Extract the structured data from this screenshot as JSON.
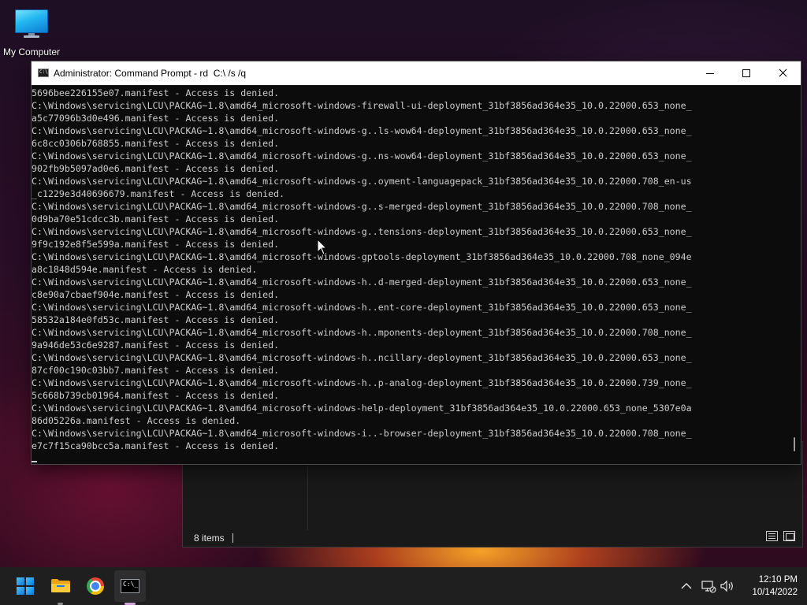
{
  "desktop": {
    "icons": [
      {
        "label": "My Computer",
        "icon": "computer-monitor-icon"
      }
    ]
  },
  "explorer": {
    "status_items": "8 items"
  },
  "cmd_window": {
    "title": "Administrator: Command Prompt - rd  C:\\ /s /q",
    "lines": [
      "5696bee226155e07.manifest - Access is denied.",
      "C:\\Windows\\servicing\\LCU\\PACKAG~1.8\\amd64_microsoft-windows-firewall-ui-deployment_31bf3856ad364e35_10.0.22000.653_none_",
      "a5c77096b3d0e496.manifest - Access is denied.",
      "C:\\Windows\\servicing\\LCU\\PACKAG~1.8\\amd64_microsoft-windows-g..ls-wow64-deployment_31bf3856ad364e35_10.0.22000.653_none_",
      "6c8cc0306b768855.manifest - Access is denied.",
      "C:\\Windows\\servicing\\LCU\\PACKAG~1.8\\amd64_microsoft-windows-g..ns-wow64-deployment_31bf3856ad364e35_10.0.22000.653_none_",
      "902fb9b5097ad0e6.manifest - Access is denied.",
      "C:\\Windows\\servicing\\LCU\\PACKAG~1.8\\amd64_microsoft-windows-g..oyment-languagepack_31bf3856ad364e35_10.0.22000.708_en-us",
      "_c1229e3d40696679.manifest - Access is denied.",
      "C:\\Windows\\servicing\\LCU\\PACKAG~1.8\\amd64_microsoft-windows-g..s-merged-deployment_31bf3856ad364e35_10.0.22000.708_none_",
      "0d9ba70e51cdcc3b.manifest - Access is denied.",
      "C:\\Windows\\servicing\\LCU\\PACKAG~1.8\\amd64_microsoft-windows-g..tensions-deployment_31bf3856ad364e35_10.0.22000.653_none_",
      "9f9c192e8f5e599a.manifest - Access is denied.",
      "C:\\Windows\\servicing\\LCU\\PACKAG~1.8\\amd64_microsoft-windows-gptools-deployment_31bf3856ad364e35_10.0.22000.708_none_094e",
      "a8c1848d594e.manifest - Access is denied.",
      "C:\\Windows\\servicing\\LCU\\PACKAG~1.8\\amd64_microsoft-windows-h..d-merged-deployment_31bf3856ad364e35_10.0.22000.653_none_",
      "c8e90a7cbaef904e.manifest - Access is denied.",
      "C:\\Windows\\servicing\\LCU\\PACKAG~1.8\\amd64_microsoft-windows-h..ent-core-deployment_31bf3856ad364e35_10.0.22000.653_none_",
      "58532a184e0fd53c.manifest - Access is denied.",
      "C:\\Windows\\servicing\\LCU\\PACKAG~1.8\\amd64_microsoft-windows-h..mponents-deployment_31bf3856ad364e35_10.0.22000.708_none_",
      "9a946de53c6e9287.manifest - Access is denied.",
      "C:\\Windows\\servicing\\LCU\\PACKAG~1.8\\amd64_microsoft-windows-h..ncillary-deployment_31bf3856ad364e35_10.0.22000.653_none_",
      "87cf00c190c03bb7.manifest - Access is denied.",
      "C:\\Windows\\servicing\\LCU\\PACKAG~1.8\\amd64_microsoft-windows-h..p-analog-deployment_31bf3856ad364e35_10.0.22000.739_none_",
      "5c668b739cb01964.manifest - Access is denied.",
      "C:\\Windows\\servicing\\LCU\\PACKAG~1.8\\amd64_microsoft-windows-help-deployment_31bf3856ad364e35_10.0.22000.653_none_5307e0a",
      "86d05226a.manifest - Access is denied.",
      "C:\\Windows\\servicing\\LCU\\PACKAG~1.8\\amd64_microsoft-windows-i..-browser-deployment_31bf3856ad364e35_10.0.22000.708_none_",
      "e7c7f15ca90bcc5a.manifest - Access is denied."
    ]
  },
  "taskbar": {
    "apps": [
      {
        "name": "Start",
        "icon": "windows-start-icon"
      },
      {
        "name": "File Explorer",
        "icon": "folder-icon",
        "running": true
      },
      {
        "name": "Google Chrome",
        "icon": "chrome-icon"
      },
      {
        "name": "Command Prompt",
        "icon": "terminal-icon",
        "active": true
      }
    ],
    "tray_icons": [
      "chevron-up-icon",
      "network-icon",
      "volume-icon"
    ],
    "time": "12:10 PM",
    "date": "10/14/2022"
  },
  "colors": {
    "console_bg": "#0c0c0c",
    "console_text": "#cccccc",
    "accent": "#0a7ad8",
    "taskbar_bg": "#1f1f1f"
  }
}
